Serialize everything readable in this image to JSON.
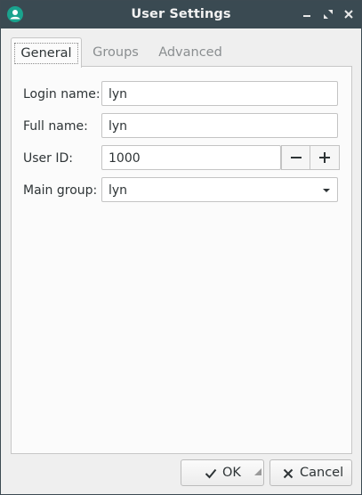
{
  "window": {
    "title": "User Settings",
    "app_icon": "user-icon",
    "controls": [
      "minimize-icon",
      "maximize-icon",
      "close-icon"
    ],
    "title_bar_color": "#3a4a52",
    "accent": "#1aa38e"
  },
  "tabs": [
    {
      "label": "General",
      "active": true
    },
    {
      "label": "Groups",
      "active": false
    },
    {
      "label": "Advanced",
      "active": false
    }
  ],
  "form": {
    "login_name": {
      "label": "Login name:",
      "value": "lyn"
    },
    "full_name": {
      "label": "Full name:",
      "value": "lyn"
    },
    "user_id": {
      "label": "User ID:",
      "value": "1000"
    },
    "main_group": {
      "label": "Main group:",
      "value": "lyn"
    }
  },
  "buttons": {
    "ok": {
      "label": "OK",
      "icon": "checkmark-icon"
    },
    "cancel": {
      "label": "Cancel",
      "icon": "x-icon"
    }
  }
}
